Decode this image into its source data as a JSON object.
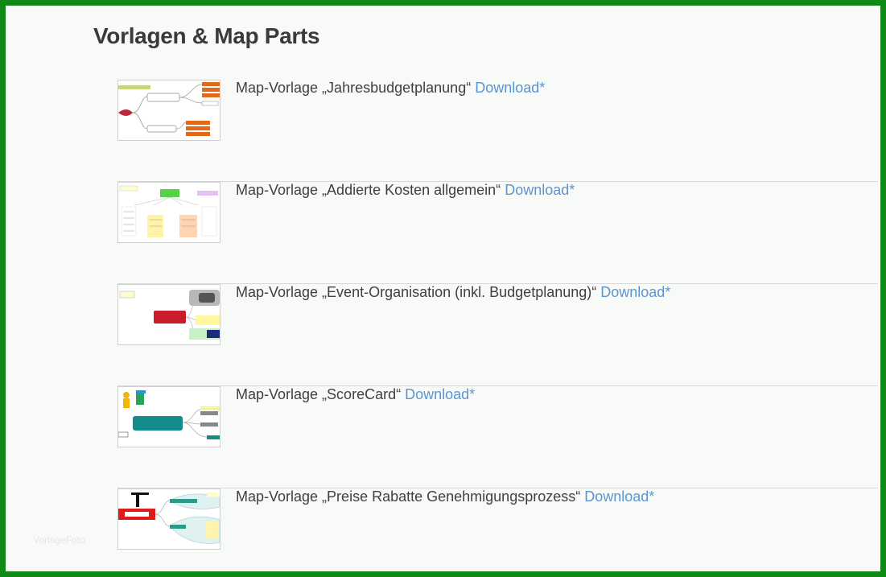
{
  "page": {
    "title": "Vorlagen & Map Parts"
  },
  "items": [
    {
      "label": "Map-Vorlage „Jahresbudgetplanung“",
      "link": "Download*"
    },
    {
      "label": "Map-Vorlage „Addierte Kosten allgemein“",
      "link": "Download*"
    },
    {
      "label": "Map-Vorlage „Event-Organisation (inkl. Budgetplanung)“",
      "link": "Download*"
    },
    {
      "label": "Map-Vorlage „ScoreCard“",
      "link": "Download*"
    },
    {
      "label": "Map-Vorlage „Preise Rabatte Genehmigungsprozess“",
      "link": "Download*"
    }
  ],
  "watermark": "VorlageFoto",
  "colors": {
    "frame": "#0f8a17",
    "link": "#5b95cf",
    "text": "#404040"
  }
}
